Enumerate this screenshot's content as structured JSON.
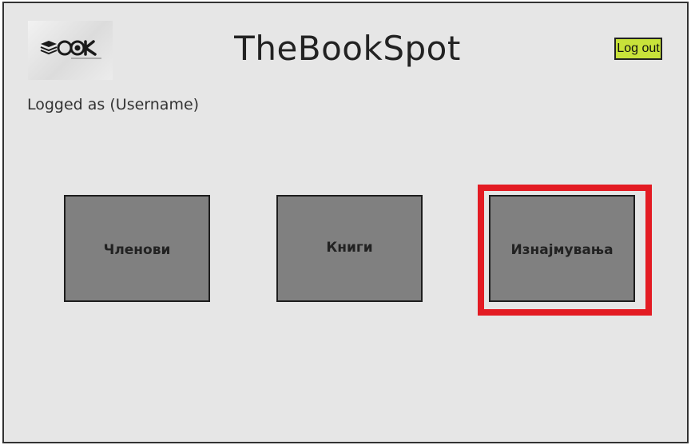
{
  "header": {
    "logo_icon": "book-stack-logo-icon",
    "logo_text": "BOOK",
    "title": "TheBookSpot",
    "logout_label": "Log out"
  },
  "user": {
    "logged_as": "Logged as (Username)"
  },
  "tiles": [
    {
      "label": "Членови"
    },
    {
      "label": "Книги"
    },
    {
      "label": "Изнајмувања",
      "highlighted": true
    }
  ],
  "colors": {
    "background": "#e6e6e6",
    "tile": "#808080",
    "logout": "#c8e23a",
    "highlight": "#e31b23"
  }
}
